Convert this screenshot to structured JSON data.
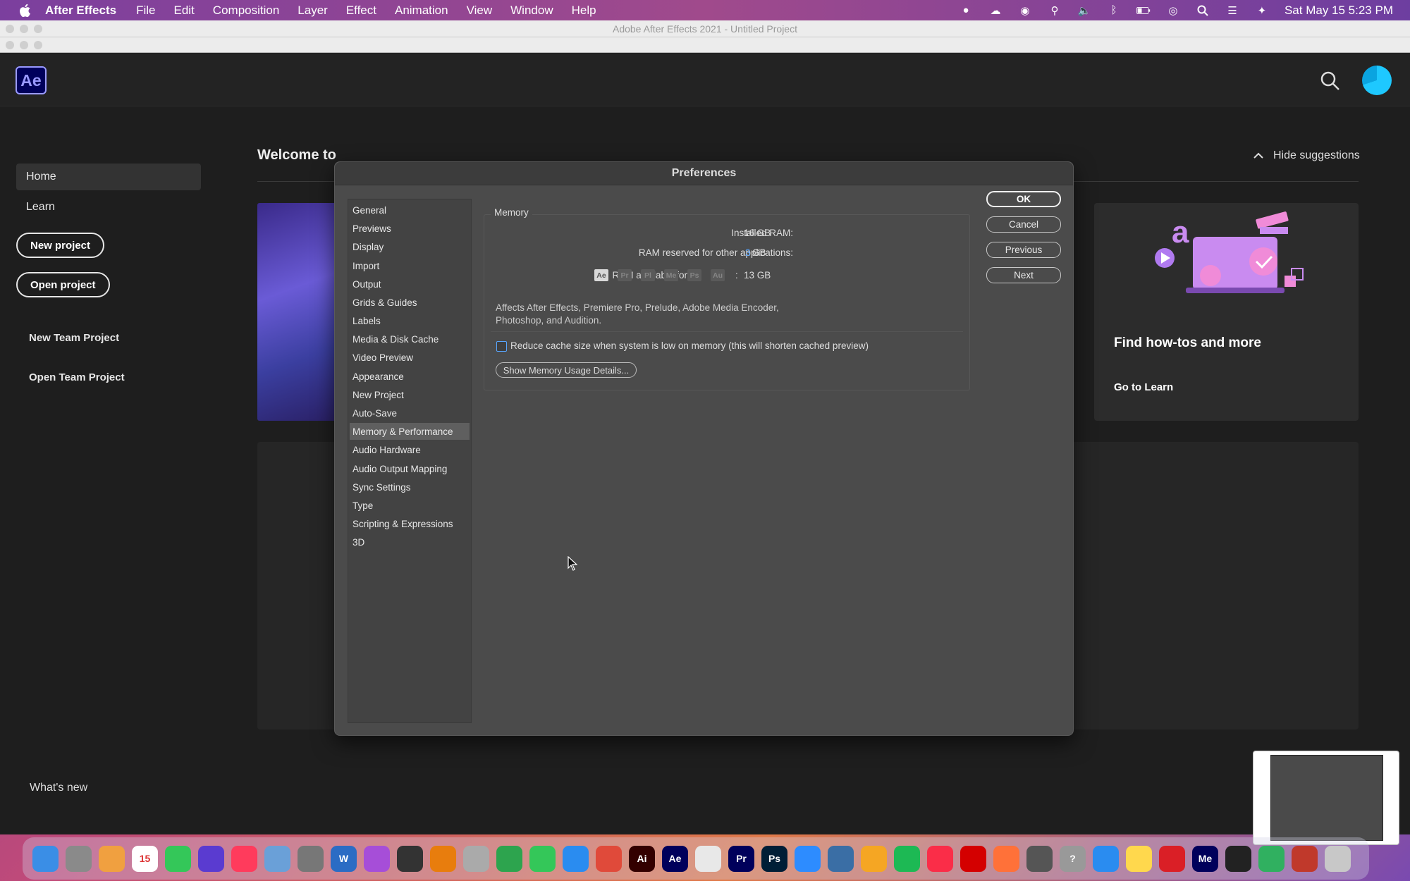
{
  "menubar": {
    "app_name": "After Effects",
    "items": [
      "File",
      "Edit",
      "Composition",
      "Layer",
      "Effect",
      "Animation",
      "View",
      "Window",
      "Help"
    ],
    "clock": "Sat May 15  5:23 PM"
  },
  "window": {
    "title": "Adobe After Effects 2021 - Untitled Project"
  },
  "header": {
    "logo": "Ae"
  },
  "home": {
    "nav": [
      "Home",
      "Learn"
    ],
    "new_project": "New project",
    "open_project": "Open project",
    "new_team_project": "New Team Project",
    "open_team_project": "Open Team Project",
    "whats_new": "What's new",
    "welcome": "Welcome to",
    "hide_suggestions": "Hide suggestions",
    "card_title": "Find how-tos and more",
    "card_link": "Go to Learn"
  },
  "prefs": {
    "title": "Preferences",
    "categories": [
      "General",
      "Previews",
      "Display",
      "Import",
      "Output",
      "Grids & Guides",
      "Labels",
      "Media & Disk Cache",
      "Video Preview",
      "Appearance",
      "New Project",
      "Auto-Save",
      "Memory & Performance",
      "Audio Hardware",
      "Audio Output Mapping",
      "Sync Settings",
      "Type",
      "Scripting & Expressions",
      "3D"
    ],
    "selected_category": "Memory & Performance",
    "memory": {
      "group_label": "Memory",
      "installed_label": "Installed RAM:",
      "installed_value": "16 GB",
      "reserved_label": "RAM reserved for other applications:",
      "reserved_value": "3",
      "reserved_unit": "GB",
      "available_label": "RAM available for",
      "apps": [
        "Ae",
        "Pr",
        "Pl",
        "Me",
        "Ps",
        "Au"
      ],
      "colon": ":",
      "available_value": "13 GB",
      "affects_text": "Affects After Effects, Premiere Pro, Prelude, Adobe Media Encoder, Photoshop, and Audition.",
      "reduce_cache_label": "Reduce cache size when system is low on memory (this will shorten cached preview)",
      "reduce_cache_checked": false,
      "details_button": "Show Memory Usage Details..."
    },
    "buttons": {
      "ok": "OK",
      "cancel": "Cancel",
      "previous": "Previous",
      "next": "Next"
    }
  },
  "dock": {
    "apps": [
      {
        "icon": "finder-icon",
        "color": "#3a8ee6",
        "label": ""
      },
      {
        "icon": "launchpad-icon",
        "color": "#8a8a8a",
        "label": ""
      },
      {
        "icon": "photos-icon",
        "color": "#f0a040",
        "label": ""
      },
      {
        "icon": "calendar-icon",
        "color": "#ffffff",
        "label": "15"
      },
      {
        "icon": "messages-icon",
        "color": "#34c759",
        "label": ""
      },
      {
        "icon": "siri-icon",
        "color": "#5a3bd0",
        "label": ""
      },
      {
        "icon": "news-icon",
        "color": "#ff3b5c",
        "label": ""
      },
      {
        "icon": "preview-icon",
        "color": "#6aa0d8",
        "label": ""
      },
      {
        "icon": "system-preferences-icon",
        "color": "#777777",
        "label": ""
      },
      {
        "icon": "word-icon",
        "color": "#2b6cc4",
        "label": "W"
      },
      {
        "icon": "podcasts-icon",
        "color": "#a64ed8",
        "label": ""
      },
      {
        "icon": "inkscape-icon",
        "color": "#333333",
        "label": ""
      },
      {
        "icon": "blender-icon",
        "color": "#e87d0d",
        "label": ""
      },
      {
        "icon": "dvd-icon",
        "color": "#aaaaaa",
        "label": ""
      },
      {
        "icon": "numbers-icon",
        "color": "#2da44e",
        "label": ""
      },
      {
        "icon": "facetime-icon",
        "color": "#34c759",
        "label": ""
      },
      {
        "icon": "safari-icon",
        "color": "#2a8cf0",
        "label": ""
      },
      {
        "icon": "davinci-icon",
        "color": "#e04a3a",
        "label": ""
      },
      {
        "icon": "illustrator-icon",
        "color": "#330000",
        "label": "Ai"
      },
      {
        "icon": "after-effects-icon",
        "color": "#00005b",
        "label": "Ae"
      },
      {
        "icon": "chrome-icon",
        "color": "#e8e8e8",
        "label": ""
      },
      {
        "icon": "premiere-icon",
        "color": "#00005b",
        "label": "Pr"
      },
      {
        "icon": "photoshop-icon",
        "color": "#001e36",
        "label": "Ps"
      },
      {
        "icon": "zoom-icon",
        "color": "#2d8cff",
        "label": ""
      },
      {
        "icon": "quicktime-icon",
        "color": "#3a6ea5",
        "label": ""
      },
      {
        "icon": "pages-icon",
        "color": "#f5a623",
        "label": ""
      },
      {
        "icon": "spotify-icon",
        "color": "#1db954",
        "label": ""
      },
      {
        "icon": "music-icon",
        "color": "#fa2d48",
        "label": ""
      },
      {
        "icon": "acrobat-icon",
        "color": "#d40000",
        "label": ""
      },
      {
        "icon": "firefox-icon",
        "color": "#ff7139",
        "label": ""
      },
      {
        "icon": "chess-icon",
        "color": "#555555",
        "label": ""
      },
      {
        "icon": "help-icon",
        "color": "#999999",
        "label": "?"
      },
      {
        "icon": "mail-icon",
        "color": "#2a8cf0",
        "label": ""
      },
      {
        "icon": "notes-icon",
        "color": "#ffd84d",
        "label": ""
      },
      {
        "icon": "creative-cloud-icon",
        "color": "#da1f26",
        "label": ""
      },
      {
        "icon": "media-encoder-icon",
        "color": "#00005b",
        "label": "Me"
      },
      {
        "icon": "activity-monitor-icon",
        "color": "#222222",
        "label": ""
      },
      {
        "icon": "screen-sharing-icon",
        "color": "#30b060",
        "label": ""
      },
      {
        "icon": "pdf-icon",
        "color": "#c0392b",
        "label": ""
      },
      {
        "icon": "trash-icon",
        "color": "#c8c8c8",
        "label": ""
      }
    ]
  }
}
